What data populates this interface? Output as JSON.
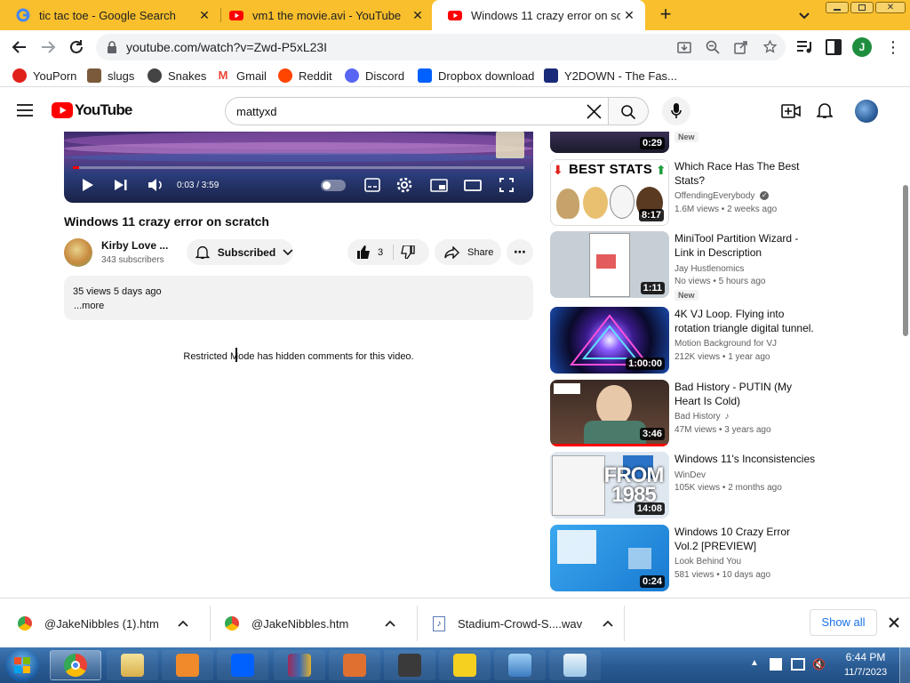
{
  "browser": {
    "tabs": [
      {
        "title": "tic tac toe - Google Search",
        "icon": "google-icon"
      },
      {
        "title": "vm1 the movie.avi - YouTube",
        "icon": "youtube-icon"
      },
      {
        "title": "Windows 11 crazy error on scratch",
        "icon": "youtube-icon"
      }
    ],
    "url": "youtube.com/watch?v=Zwd-P5xL23I",
    "profile_initial": "J",
    "bookmarks": [
      {
        "label": "YouPorn",
        "color": "#e0211b"
      },
      {
        "label": "slugs",
        "color": "#7a5a3a"
      },
      {
        "label": "Snakes",
        "color": "#444"
      },
      {
        "label": "Gmail",
        "color": "#ea4335"
      },
      {
        "label": "Reddit",
        "color": "#ff4500"
      },
      {
        "label": "Discord",
        "color": "#5865f2"
      },
      {
        "label": "Dropbox download",
        "color": "#0061fe"
      },
      {
        "label": "Y2DOWN - The Fas...",
        "color": "#1a2a7a"
      }
    ]
  },
  "youtube": {
    "logo_text": "YouTube",
    "search_value": "mattyxd",
    "video": {
      "time": "0:03 / 3:59",
      "progress": 0.013,
      "title": "Windows 11 crazy error on scratch",
      "channel": "Kirby Love ...",
      "subscribers": "343 subscribers",
      "subscribed_label": "Subscribed",
      "likes": "3",
      "share_label": "Share",
      "views_date": "35 views  5 days ago",
      "more_label": "...more",
      "comments_notice": "Restricted Mode has hidden comments for this video."
    },
    "sidebar_partial": {
      "duration": "0:29",
      "badge": "New"
    },
    "sidebar": [
      {
        "title": "Which Race Has The Best Stats?",
        "channel": "OffendingEverybody",
        "meta": "1.6M views • 2 weeks ago",
        "duration": "8:17",
        "verified": true,
        "badge": "",
        "thumb_text": "BEST STATS"
      },
      {
        "title": "MiniTool Partition Wizard - Link in Description",
        "channel": "Jay Hustlenomics",
        "meta": "No views • 5 hours ago",
        "duration": "1:11",
        "badge": "New"
      },
      {
        "title": "4K VJ Loop. Flying into rotation triangle digital tunnel.",
        "channel": "Motion Background for VJ",
        "meta": "212K views • 1 year ago",
        "duration": "1:00:00",
        "badge": ""
      },
      {
        "title": "Bad History - PUTIN (My Heart Is Cold)",
        "channel": "Bad History",
        "meta": "47M views • 3 years ago",
        "duration": "3:46",
        "badge": "",
        "music": true
      },
      {
        "title": "Windows 11's Inconsistencies",
        "channel": "WinDev",
        "meta": "105K views • 2 months ago",
        "duration": "14:08",
        "badge": "",
        "thumb_text": "FROM 1985"
      },
      {
        "title": "Windows 10 Crazy Error Vol.2 [PREVIEW]",
        "channel": "Look Behind You",
        "meta": "581 views • 10 days ago",
        "duration": "0:24",
        "badge": ""
      }
    ]
  },
  "downloads": {
    "items": [
      {
        "name": "@JakeNibbles (1).htm"
      },
      {
        "name": "@JakeNibbles.htm"
      },
      {
        "name": "Stadium-Crowd-S....wav"
      }
    ],
    "show_all": "Show all"
  },
  "taskbar": {
    "time": "6:44 PM",
    "date": "11/7/2023"
  }
}
